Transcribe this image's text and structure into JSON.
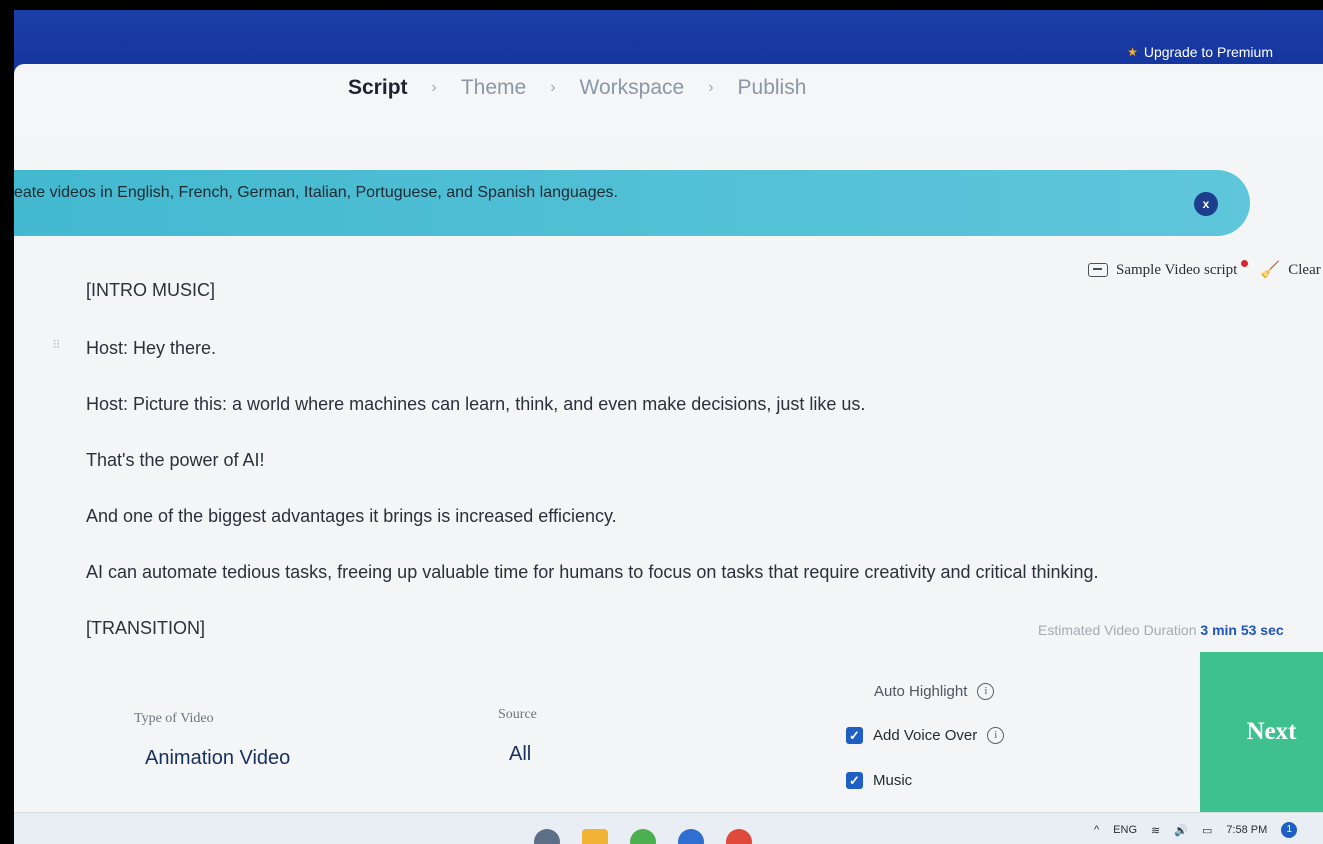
{
  "header": {
    "upgrade_label": "Upgrade to Premium",
    "upgrade_icon": "star-icon"
  },
  "steps": [
    {
      "label": "Script",
      "active": true
    },
    {
      "label": "Theme",
      "active": false
    },
    {
      "label": "Workspace",
      "active": false
    },
    {
      "label": "Publish",
      "active": false
    }
  ],
  "steps_separator": ">",
  "banner": {
    "text": "eate videos in English, French, German, Italian, Portuguese, and Spanish languages.",
    "close_label": "x",
    "color": "#4dbfd5"
  },
  "toolbar": {
    "sample_label": "Sample Video script",
    "clear_label": "Clear"
  },
  "script_lines": [
    "[INTRO MUSIC]",
    "Host: Hey there.",
    "Host: Picture this: a world where machines can learn, think, and even make decisions, just like us.",
    "That's the power of AI!",
    "And one of the biggest advantages it brings is increased efficiency.",
    "AI can automate tedious tasks, freeing up valuable time for humans to focus on tasks that require creativity and critical thinking.",
    "[TRANSITION]"
  ],
  "duration": {
    "label": "Estimated Video Duration",
    "value": "3 min 53 sec"
  },
  "options": {
    "type_label": "Type of Video",
    "type_value": "Animation Video",
    "source_label": "Source",
    "source_value": "All",
    "auto_highlight_label": "Auto Highlight",
    "voice_over_label": "Add Voice Over",
    "voice_over_checked": true,
    "music_label": "Music",
    "music_checked": true
  },
  "next_label": "Next",
  "taskbar": {
    "language": "ENG",
    "time": "7:58 PM",
    "notification_count": "1"
  },
  "colors": {
    "header": "#13349b",
    "accent": "#1f5fc4",
    "next": "#3ec08f"
  }
}
